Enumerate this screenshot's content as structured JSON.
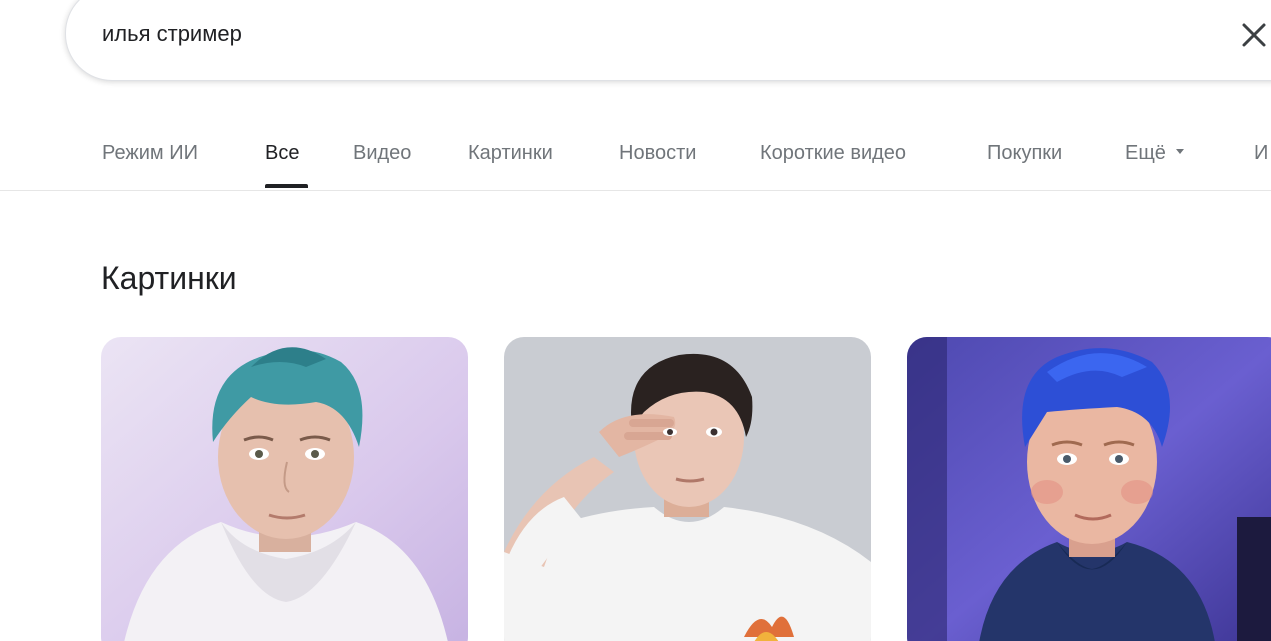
{
  "search": {
    "query": "илья стример"
  },
  "tabs": [
    {
      "label": "Режим ИИ",
      "active": false
    },
    {
      "label": "Все",
      "active": true
    },
    {
      "label": "Видео",
      "active": false
    },
    {
      "label": "Картинки",
      "active": false
    },
    {
      "label": "Новости",
      "active": false
    },
    {
      "label": "Короткие видео",
      "active": false
    },
    {
      "label": "Покупки",
      "active": false
    },
    {
      "label": "Ещё",
      "active": false
    },
    {
      "label": "И",
      "active": false
    }
  ],
  "images_section": {
    "title": "Картинки"
  },
  "colors": {
    "accent": "#202124",
    "muted": "#70757a",
    "border": "#dfe1e5"
  }
}
